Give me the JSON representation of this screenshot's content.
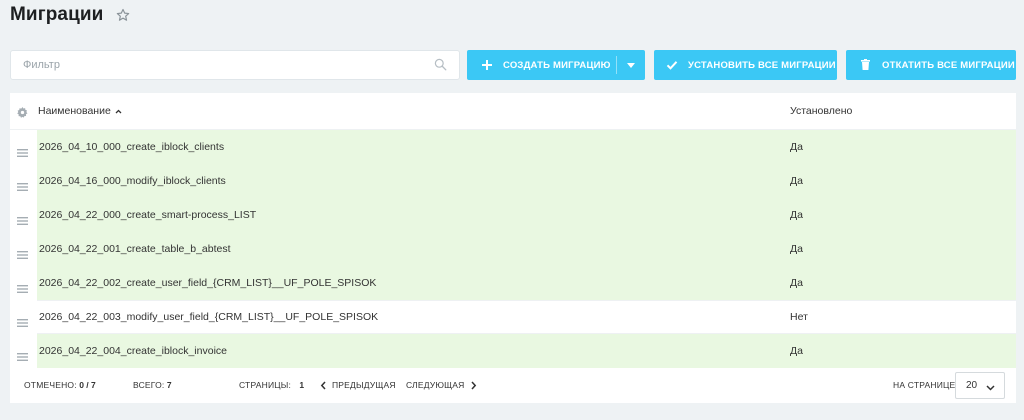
{
  "page": {
    "title": "Миграции"
  },
  "filter": {
    "placeholder": "Фильтр"
  },
  "toolbar": {
    "create_label": "СОЗДАТЬ МИГРАЦИЮ",
    "install_all_label": "УСТАНОВИТЬ ВСЕ МИГРАЦИИ",
    "rollback_all_label": "ОТКАТИТЬ ВСЕ МИГРАЦИИ"
  },
  "table": {
    "columns": {
      "name": "Наименование",
      "installed": "Установлено"
    },
    "rows": [
      {
        "name": "2026_04_10_000_create_iblock_clients",
        "installed": "Да"
      },
      {
        "name": "2026_04_16_000_modify_iblock_clients",
        "installed": "Да"
      },
      {
        "name": "2026_04_22_000_create_smart-process_LIST",
        "installed": "Да"
      },
      {
        "name": "2026_04_22_001_create_table_b_abtest",
        "installed": "Да"
      },
      {
        "name": "2026_04_22_002_create_user_field_{CRM_LIST}__UF_POLE_SPISOK",
        "installed": "Да"
      },
      {
        "name": "2026_04_22_003_modify_user_field_{CRM_LIST}__UF_POLE_SPISOK",
        "installed": "Нет"
      },
      {
        "name": "2026_04_22_004_create_iblock_invoice",
        "installed": "Да"
      }
    ]
  },
  "footer": {
    "checked_label": "ОТМЕЧЕНО:",
    "checked_value": "0 / 7",
    "total_label": "ВСЕГО:",
    "total_value": "7",
    "pages_label": "СТРАНИЦЫ:",
    "pages_value": "1",
    "prev_label": "ПРЕДЫДУЩАЯ",
    "next_label": "СЛЕДУЮЩАЯ",
    "per_page_label": "НА СТРАНИЦЕ:",
    "per_page_value": "20"
  },
  "colors": {
    "accent": "#3bc8f5",
    "installed_row": "#e9f8e1",
    "background": "#eef2f4"
  },
  "icons": {
    "star": "star-icon",
    "search": "search-icon",
    "plus": "plus-icon",
    "check": "check-icon",
    "trash": "trash-icon",
    "gear": "gear-icon",
    "drag": "drag-handle-icon",
    "sort": "sort-asc-icon"
  }
}
